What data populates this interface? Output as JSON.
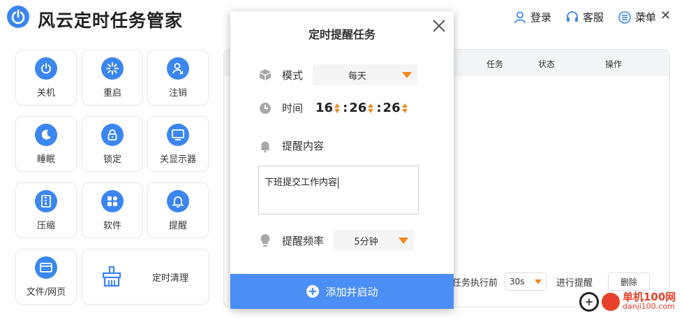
{
  "app": {
    "title": "风云定时任务管家"
  },
  "topnav": {
    "login": "登录",
    "service": "客服",
    "menu": "菜单",
    "minimize": "—",
    "close": "✕"
  },
  "tiles": [
    {
      "label": "关机",
      "icon": "power-icon"
    },
    {
      "label": "重启",
      "icon": "restart-icon"
    },
    {
      "label": "注销",
      "icon": "logout-user-icon"
    },
    {
      "label": "睡眠",
      "icon": "moon-icon"
    },
    {
      "label": "锁定",
      "icon": "lock-icon"
    },
    {
      "label": "关显示器",
      "icon": "monitor-icon"
    },
    {
      "label": "压缩",
      "icon": "zip-icon"
    },
    {
      "label": "软件",
      "icon": "apps-grid-icon"
    },
    {
      "label": "提醒",
      "icon": "bell-icon"
    },
    {
      "label": "文件/网页",
      "icon": "browser-window-icon"
    },
    {
      "label": "定时清理",
      "icon": "broom-icon"
    }
  ],
  "table": {
    "columns": [
      "任务",
      "状态",
      "操作"
    ]
  },
  "bottom": {
    "prefix": "任务执行前",
    "select_value": "30s",
    "suffix": "进行提醒",
    "delete": "删除"
  },
  "modal": {
    "title": "定时提醒任务",
    "mode_label": "模式",
    "mode_value": "每天",
    "time_label": "时间",
    "hour": "16",
    "minute": "26",
    "second": "26",
    "content_label": "提醒内容",
    "content_value": "下班提交工作内容",
    "freq_label": "提醒频率",
    "freq_value": "5分钟",
    "submit": "添加并启动"
  },
  "watermark": {
    "line1": "单机100网",
    "line2": "danji100.com"
  },
  "colors": {
    "accent": "#3b86f0",
    "button": "#4b8ef5",
    "arrow": "#f08a1e"
  }
}
